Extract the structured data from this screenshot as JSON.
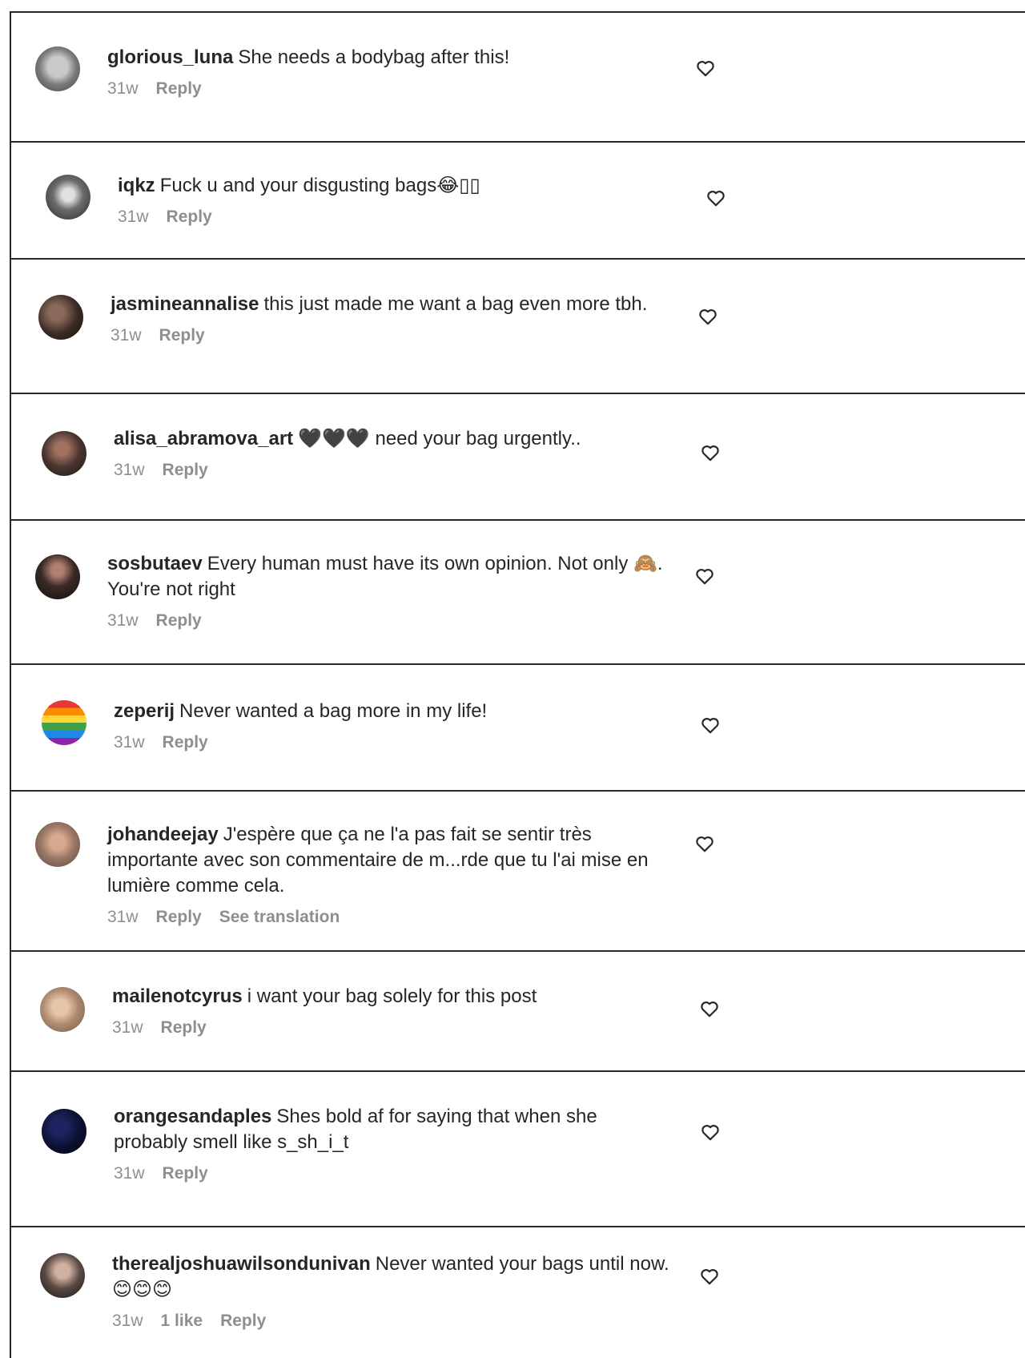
{
  "comments": [
    {
      "username": "glorious_luna",
      "text": "She needs a bodybag after this!",
      "time": "31w",
      "reply": "Reply",
      "avatar_color": "#8a8a8a"
    },
    {
      "username": "iqkz",
      "text": "Fuck u and your disgusting bags😂▯▯",
      "time": "31w",
      "reply": "Reply",
      "avatar_color": "#555555"
    },
    {
      "username": "jasmineannalise",
      "text": "this just made me want a bag even more tbh.",
      "time": "31w",
      "reply": "Reply",
      "avatar_color": "#3b2a24"
    },
    {
      "username": "alisa_abramova_art",
      "text": "🖤🖤🖤 need your bag urgently..",
      "time": "31w",
      "reply": "Reply",
      "avatar_color": "#4a3530"
    },
    {
      "username": "sosbutaev",
      "text": "Every human must have its own opinion. Not only 🙈. You're not right",
      "time": "31w",
      "reply": "Reply",
      "avatar_color": "#2e2624"
    },
    {
      "username": "zeperij",
      "text": "Never wanted a bag more in my life!",
      "time": "31w",
      "reply": "Reply",
      "avatar_color": "rainbow"
    },
    {
      "username": "johandeejay",
      "text": "J'espère que ça ne l'a pas fait se sentir très importante avec son commentaire de m...rde que tu l'ai mise en lumière comme cela.",
      "time": "31w",
      "reply": "Reply",
      "translate": "See translation",
      "avatar_color": "#9a7866"
    },
    {
      "username": "mailenotcyrus",
      "text": "i want your bag solely for this post",
      "time": "31w",
      "reply": "Reply",
      "avatar_color": "#b08a70"
    },
    {
      "username": "orangesandaples",
      "text": "Shes bold af for saying that when she probably smell like s_sh_i_t",
      "time": "31w",
      "reply": "Reply",
      "avatar_color": "#0b1030"
    },
    {
      "username": "therealjoshuawilsondunivan",
      "text": "Never wanted your bags until now. 😊😊😊",
      "time": "31w",
      "likes": "1 like",
      "reply": "Reply",
      "avatar_color": "#3a3a3a"
    }
  ]
}
